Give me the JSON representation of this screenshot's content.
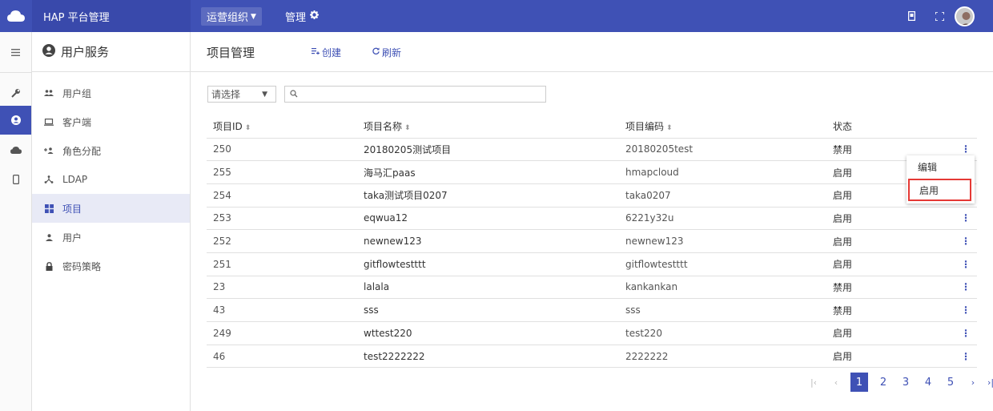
{
  "topbar": {
    "logo": "cloud-icon",
    "brand": "HAP 平台管理",
    "org_button": "运营组织",
    "manage_label": "管理",
    "icons": [
      "mobile-icon",
      "fullscreen-icon"
    ]
  },
  "rail": {
    "items": [
      "menu-icon",
      "wrench-icon",
      "account-circle-icon",
      "cloud-icon",
      "phone-icon"
    ]
  },
  "sidebar": {
    "title": "用户服务",
    "items": [
      {
        "label": "用户组",
        "icon": "people-icon"
      },
      {
        "label": "客户端",
        "icon": "laptop-icon"
      },
      {
        "label": "角色分配",
        "icon": "person-add-icon"
      },
      {
        "label": "LDAP",
        "icon": "hierarchy-icon"
      },
      {
        "label": "项目",
        "icon": "grid-icon"
      },
      {
        "label": "用户",
        "icon": "person-icon"
      },
      {
        "label": "密码策略",
        "icon": "lock-icon"
      }
    ]
  },
  "content": {
    "title": "项目管理",
    "create_label": "创建",
    "refresh_label": "刷新",
    "filter_placeholder": "请选择",
    "search_value": ""
  },
  "table": {
    "columns": [
      "项目ID",
      "项目名称",
      "项目编码",
      "状态"
    ],
    "rows": [
      {
        "id": "250",
        "name": "20180205测试项目",
        "code": "20180205test",
        "status": "禁用"
      },
      {
        "id": "255",
        "name": "海马汇paas",
        "code": "hmapcloud",
        "status": "启用"
      },
      {
        "id": "254",
        "name": "taka测试项目0207",
        "code": "taka0207",
        "status": "启用"
      },
      {
        "id": "253",
        "name": "eqwua12",
        "code": "6221y32u",
        "status": "启用"
      },
      {
        "id": "252",
        "name": "newnew123",
        "code": "newnew123",
        "status": "启用"
      },
      {
        "id": "251",
        "name": "gitflowtestttt",
        "code": "gitflowtestttt",
        "status": "启用"
      },
      {
        "id": "23",
        "name": "lalala",
        "code": "kankankan",
        "status": "禁用"
      },
      {
        "id": "43",
        "name": "sss",
        "code": "sss",
        "status": "禁用"
      },
      {
        "id": "249",
        "name": "wttest220",
        "code": "test220",
        "status": "启用"
      },
      {
        "id": "46",
        "name": "test2222222",
        "code": "2222222",
        "status": "启用"
      }
    ]
  },
  "popup": {
    "items": [
      "编辑",
      "启用"
    ]
  },
  "pagination": {
    "current": "1",
    "pages": [
      "2",
      "3",
      "4",
      "5"
    ]
  },
  "colors": {
    "primary": "#3f51b5",
    "highlight": "#e53935"
  }
}
